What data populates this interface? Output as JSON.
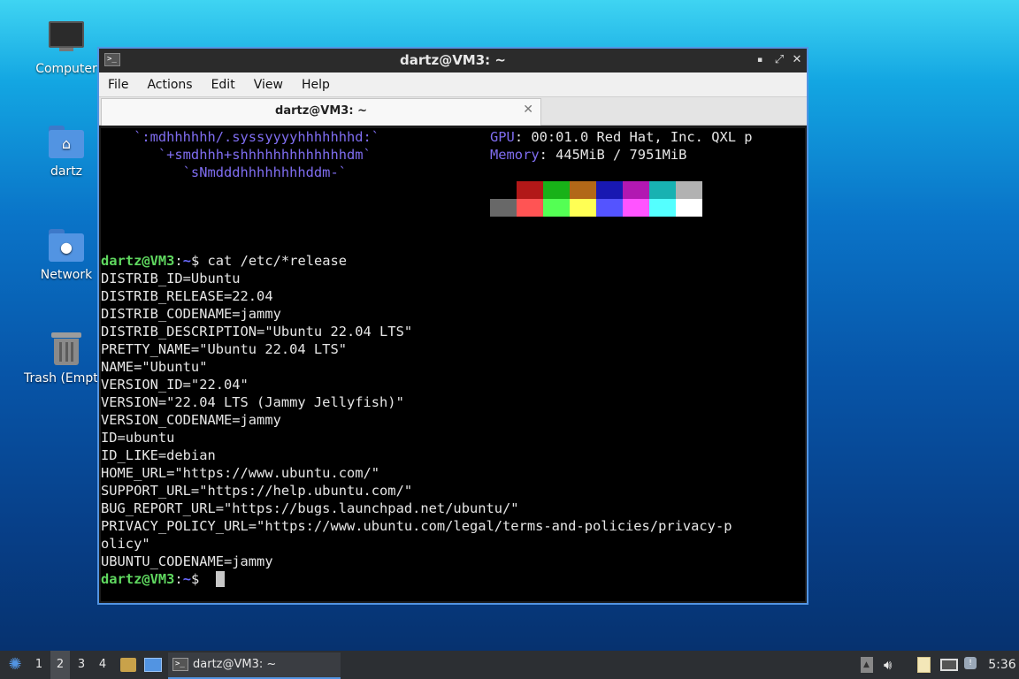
{
  "desktop": {
    "icons": [
      {
        "label": "Computer",
        "icon": "computer-icon"
      },
      {
        "label": "dartz",
        "icon": "home-folder-icon"
      },
      {
        "label": "Network",
        "icon": "network-folder-icon"
      },
      {
        "label": "Trash (Empty)",
        "icon": "trash-icon"
      }
    ]
  },
  "window": {
    "title": "dartz@VM3: ~",
    "controls": {
      "minimize": "▪",
      "maximize": "⤢",
      "close": "✕"
    },
    "menu": [
      "File",
      "Actions",
      "Edit",
      "View",
      "Help"
    ],
    "tab": {
      "label": "dartz@VM3: ~",
      "close": "✕"
    }
  },
  "terminal": {
    "ascii": [
      "    `:mdhhhhhh/.syssyyyyhhhhhhhd:`",
      "       `+smdhhh+shhhhhhhhhhhhhdm`",
      "          `sNmdddhhhhhhhhddm-`"
    ],
    "sysinfo": [
      {
        "label": "GPU",
        "value": ": 00:01.0 Red Hat, Inc. QXL p"
      },
      {
        "label": "Memory",
        "value": ": 445MiB / 7951MiB"
      }
    ],
    "palette_top": [
      "#000000",
      "#b21818",
      "#18b218",
      "#b26818",
      "#1818b2",
      "#b218b2",
      "#18b2b2",
      "#b2b2b2"
    ],
    "palette_bottom": [
      "#686868",
      "#ff5454",
      "#54ff54",
      "#ffff54",
      "#5454ff",
      "#ff54ff",
      "#54ffff",
      "#ffffff"
    ],
    "prompt_user": "dartz@VM3",
    "prompt_sep": ":",
    "prompt_path": "~",
    "prompt_symbol": "$",
    "command": " cat /etc/*release",
    "output": [
      "DISTRIB_ID=Ubuntu",
      "DISTRIB_RELEASE=22.04",
      "DISTRIB_CODENAME=jammy",
      "DISTRIB_DESCRIPTION=\"Ubuntu 22.04 LTS\"",
      "PRETTY_NAME=\"Ubuntu 22.04 LTS\"",
      "NAME=\"Ubuntu\"",
      "VERSION_ID=\"22.04\"",
      "VERSION=\"22.04 LTS (Jammy Jellyfish)\"",
      "VERSION_CODENAME=jammy",
      "ID=ubuntu",
      "ID_LIKE=debian",
      "HOME_URL=\"https://www.ubuntu.com/\"",
      "SUPPORT_URL=\"https://help.ubuntu.com/\"",
      "BUG_REPORT_URL=\"https://bugs.launchpad.net/ubuntu/\"",
      "PRIVACY_POLICY_URL=\"https://www.ubuntu.com/legal/terms-and-policies/privacy-p",
      "olicy\"",
      "UBUNTU_CODENAME=jammy"
    ]
  },
  "taskbar": {
    "workspaces": [
      "1",
      "2",
      "3",
      "4"
    ],
    "active_workspace": "2",
    "task_label": "dartz@VM3: ~",
    "clock": "5:36"
  }
}
